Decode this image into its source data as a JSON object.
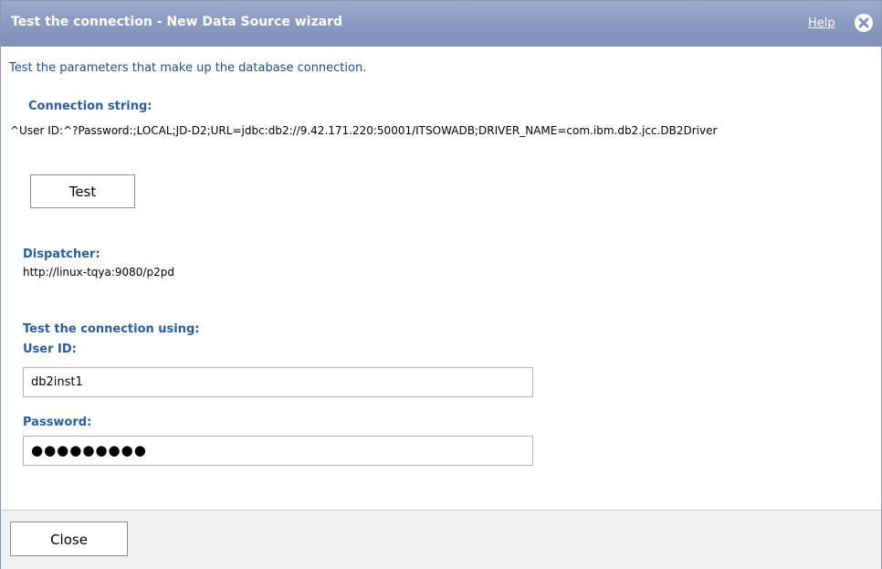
{
  "window": {
    "title": "Test the connection - New Data Source wizard",
    "help_label": "Help"
  },
  "intro_text": "Test the parameters that make up the database connection.",
  "connection": {
    "label": "Connection string:",
    "value": "^User ID:^?Password:;LOCAL;JD-D2;URL=jdbc:db2://9.42.171.220:50001/ITSOWADB;DRIVER_NAME=com.ibm.db2.jcc.DB2Driver",
    "test_button_label": "Test"
  },
  "dispatcher": {
    "label": "Dispatcher:",
    "value": "http://linux-tqya:9080/p2pd"
  },
  "test_using": {
    "label": "Test the connection using:",
    "user_id_label": "User ID:",
    "user_id_value": "db2inst1",
    "password_label": "Password:",
    "password_value": "●●●●●●●●●"
  },
  "footer": {
    "close_label": "Close"
  },
  "colors": {
    "titlebar": "#8999bf",
    "label_blue": "#2b5d9c",
    "intro_blue": "#1f4e8c",
    "footer_bg": "#f0f0f0"
  },
  "icons": {
    "title_close": "close-circle-icon"
  }
}
